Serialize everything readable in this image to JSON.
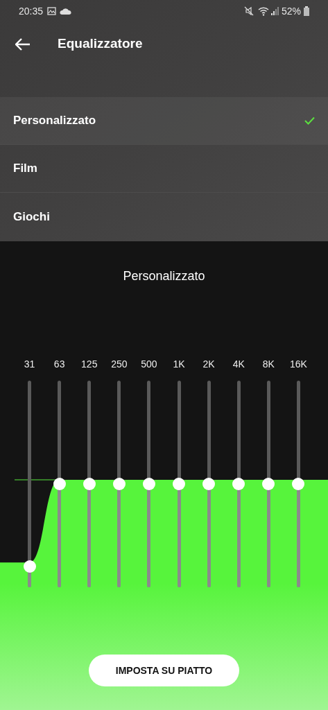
{
  "status_bar": {
    "time": "20:35",
    "battery": "52%"
  },
  "header": {
    "title": "Equalizzatore"
  },
  "presets": [
    {
      "label": "Personalizzato",
      "selected": true
    },
    {
      "label": "Film",
      "selected": false
    },
    {
      "label": "Giochi",
      "selected": false
    }
  ],
  "equalizer": {
    "title": "Personalizzato",
    "bands": [
      {
        "label": "31",
        "level": 0.1
      },
      {
        "label": "63",
        "level": 0.5
      },
      {
        "label": "125",
        "level": 0.5
      },
      {
        "label": "250",
        "level": 0.5
      },
      {
        "label": "500",
        "level": 0.5
      },
      {
        "label": "1K",
        "level": 0.5
      },
      {
        "label": "2K",
        "level": 0.5
      },
      {
        "label": "4K",
        "level": 0.5
      },
      {
        "label": "8K",
        "level": 0.5
      },
      {
        "label": "16K",
        "level": 0.5
      }
    ]
  },
  "flat_button": "IMPOSTA SU PIATTO"
}
